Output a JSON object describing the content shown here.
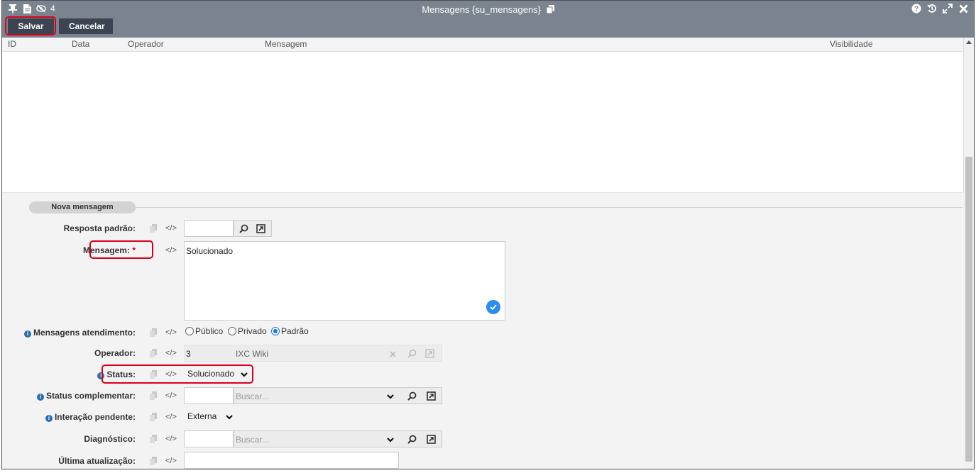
{
  "window": {
    "title": "Mensagens {su_mensagens}",
    "badge_count": "4"
  },
  "toolbar": {
    "save_label": "Salvar",
    "cancel_label": "Cancelar"
  },
  "grid": {
    "columns": [
      "ID",
      "Data",
      "Operador",
      "Mensagem",
      "Visibilidade"
    ]
  },
  "section": {
    "title": "Nova mensagem"
  },
  "form": {
    "resposta_padrao": {
      "label": "Resposta padrão:",
      "value": ""
    },
    "mensagem": {
      "label": "Mensagem:",
      "required_mark": "*",
      "value": "Solucionado"
    },
    "mensagens_atendimento": {
      "label": "Mensagens atendimento:",
      "options": [
        "Público",
        "Privado",
        "Padrão"
      ],
      "selected": "Padrão"
    },
    "operador": {
      "label": "Operador:",
      "id": "3",
      "name": "IXC Wiki"
    },
    "status": {
      "label": "Status:",
      "value": "Solucionado"
    },
    "status_complementar": {
      "label": "Status complementar:",
      "placeholder": "Buscar..."
    },
    "interacao_pendente": {
      "label": "Interação pendente:",
      "value": "Externa"
    },
    "diagnostico": {
      "label": "Diagnóstico:",
      "placeholder": "Buscar..."
    },
    "ultima_atualizacao": {
      "label": "Última atualização:",
      "value": ""
    }
  },
  "code_glyph": "</>",
  "icons": {
    "pin": "pin-icon",
    "doc": "document-icon",
    "hidden": "eye-slash-icon",
    "help": "help-icon",
    "history": "history-icon",
    "maximize": "maximize-icon",
    "close": "close-icon"
  },
  "colors": {
    "titlebar": "#7b848e",
    "button": "#3b4450",
    "highlight": "#d9001b",
    "accent": "#2d8cf0"
  }
}
